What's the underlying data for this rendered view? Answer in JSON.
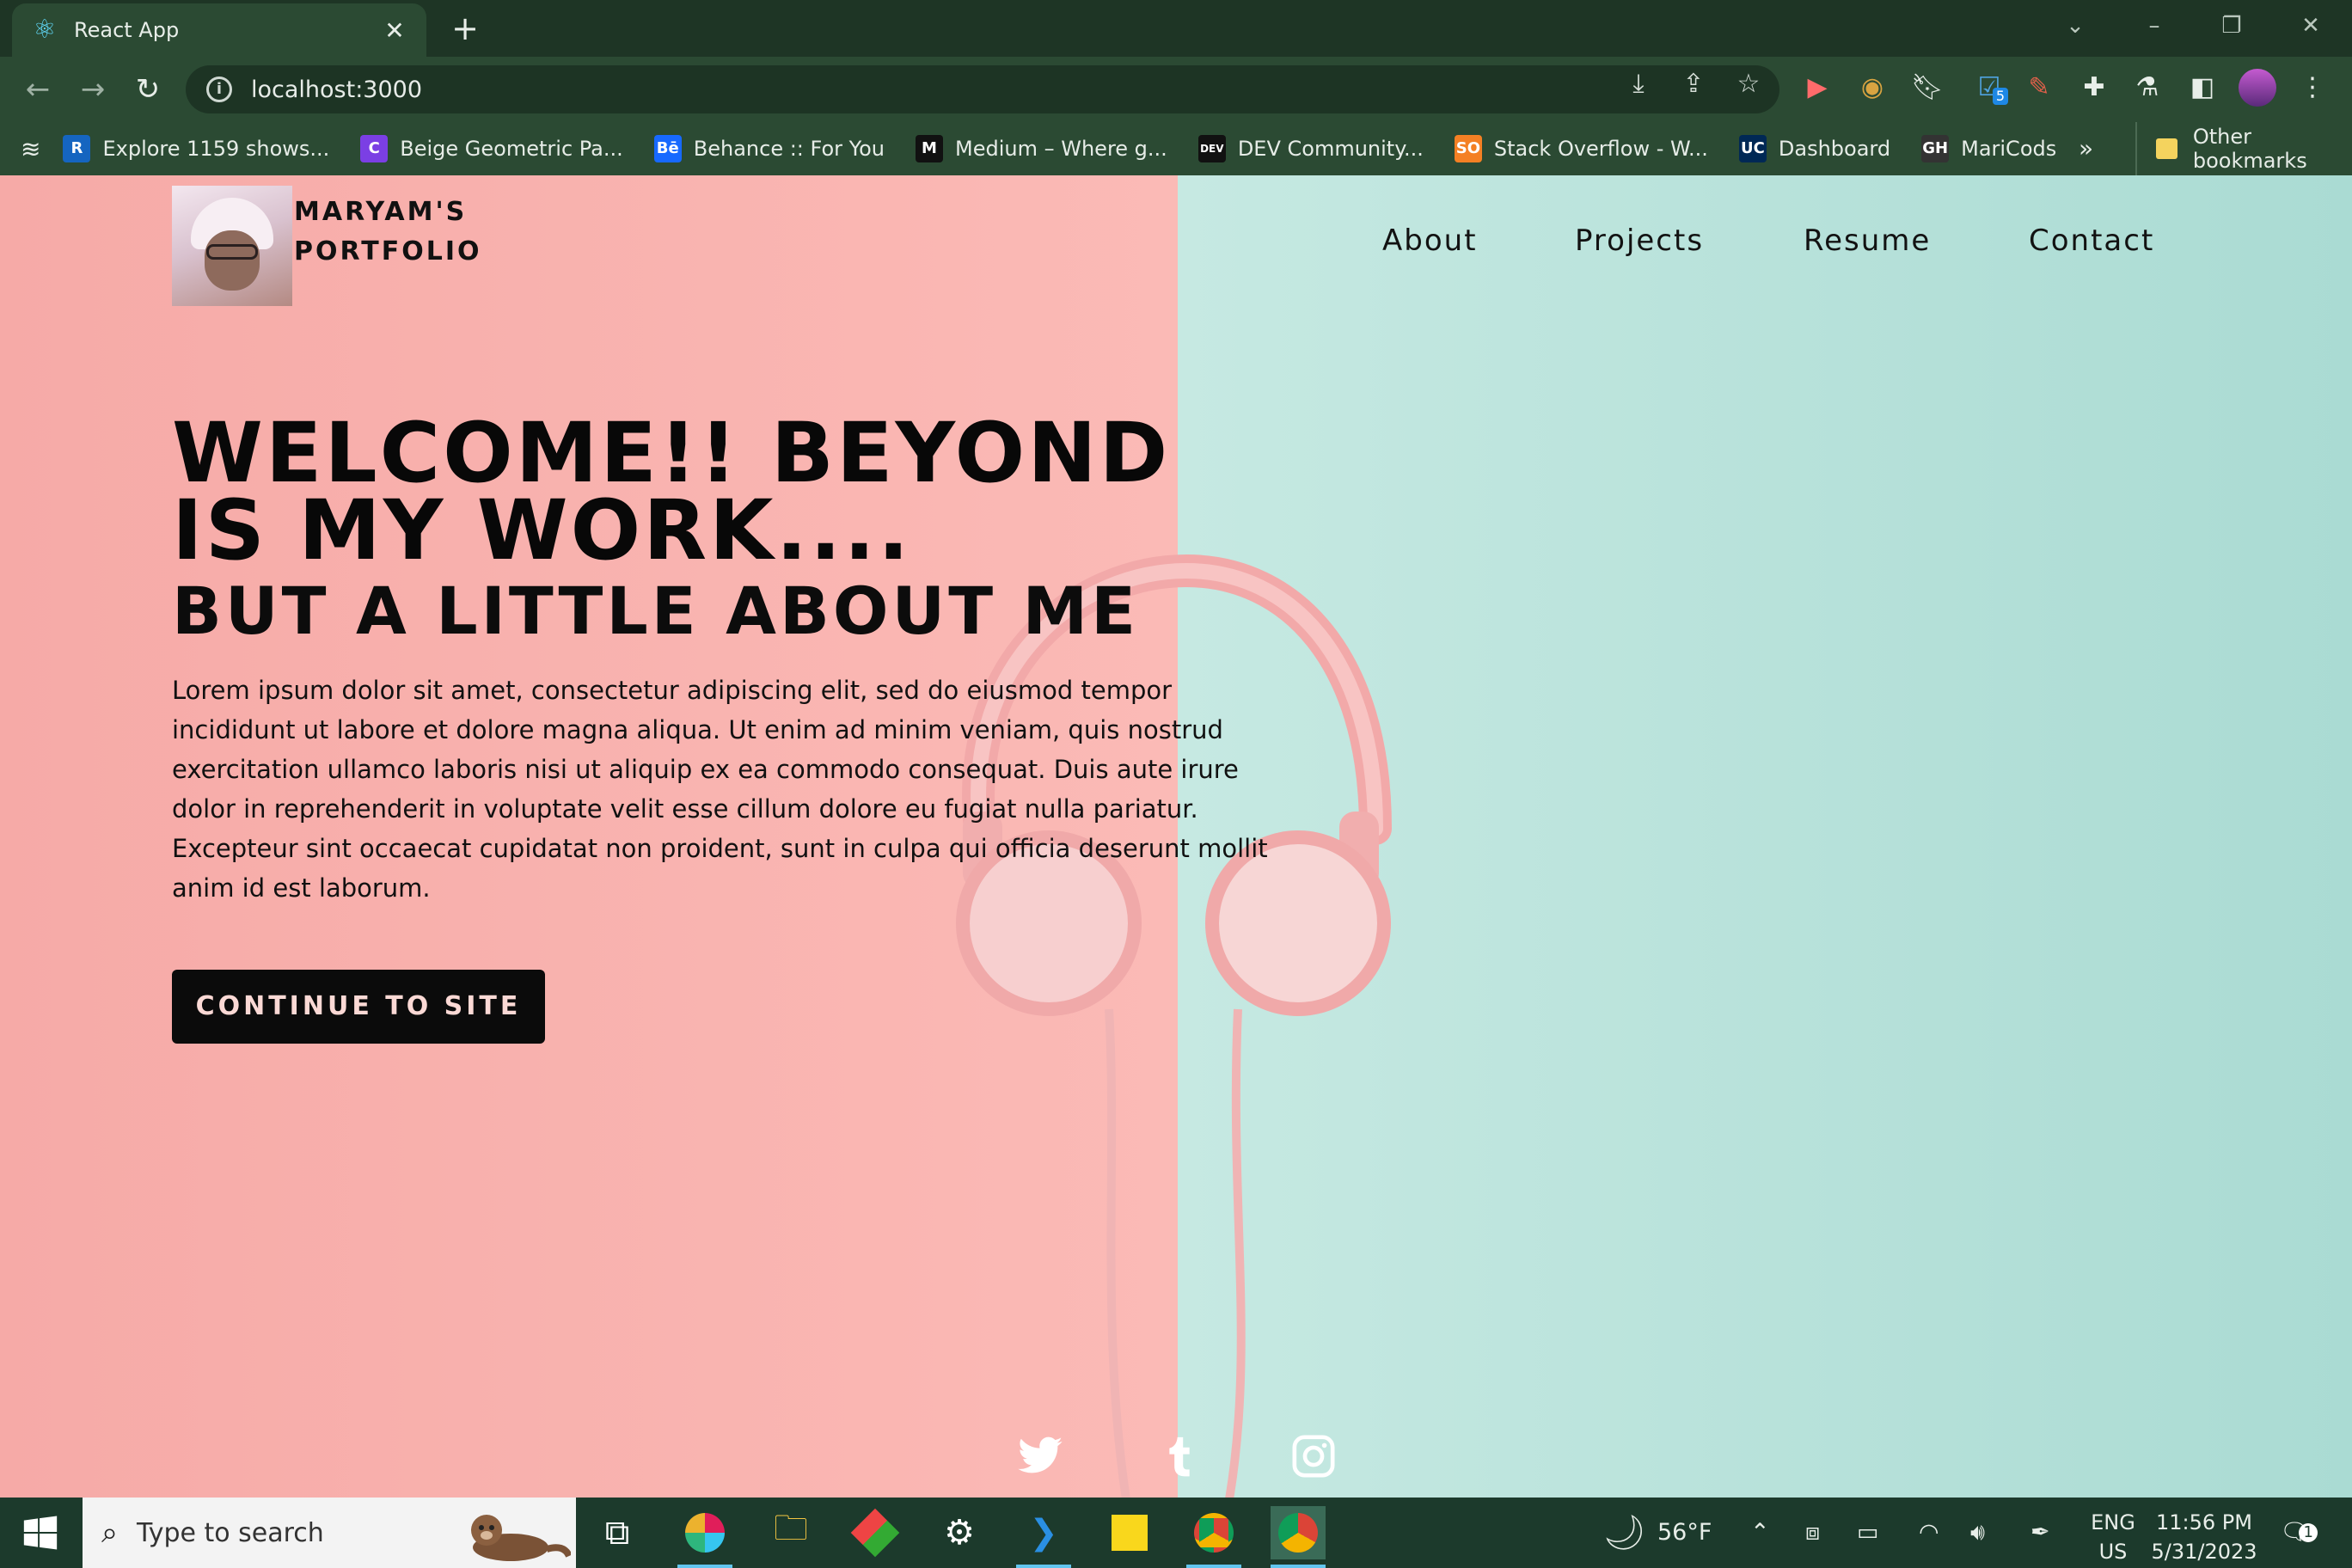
{
  "browser": {
    "tab_title": "React App",
    "url": "localhost:3000",
    "bookmarks": [
      {
        "label": "Explore 1159 shows...",
        "icon": "R"
      },
      {
        "label": "Beige Geometric Pa...",
        "icon": "C"
      },
      {
        "label": "Behance :: For You",
        "icon": "Bē"
      },
      {
        "label": "Medium – Where g...",
        "icon": "M"
      },
      {
        "label": "DEV Community...",
        "icon": "DEV"
      },
      {
        "label": "Stack Overflow - W...",
        "icon": "SO"
      },
      {
        "label": "Dashboard",
        "icon": "UC"
      },
      {
        "label": "MariCods",
        "icon": "GH"
      }
    ],
    "overflow_label": "»",
    "other_bookmarks": "Other bookmarks",
    "extension_badge": "5"
  },
  "page": {
    "brand_line1": "MARYAM'S",
    "brand_line2": "PORTFOLIO",
    "nav": [
      "About",
      "Projects",
      "Resume",
      "Contact"
    ],
    "headline": "WELCOME!! BEYOND IS MY WORK....",
    "subheadline": "BUT A LITTLE ABOUT ME",
    "body": "Lorem ipsum dolor sit amet, consectetur adipiscing elit, sed do eiusmod tempor incididunt ut labore et dolore magna aliqua. Ut enim ad minim veniam, quis nostrud exercitation ullamco laboris nisi ut aliquip ex ea commodo consequat. Duis aute irure dolor in reprehenderit in voluptate velit esse cillum dolore eu fugiat nulla pariatur. Excepteur sint occaecat cupidatat non proident, sunt in culpa qui officia deserunt mollit anim id est laborum.",
    "cta": "CONTINUE TO SITE",
    "social": [
      "twitter-icon",
      "tumblr-icon",
      "instagram-icon"
    ],
    "colors": {
      "pink": "#fbbab6",
      "teal": "#c6e9e2",
      "button": "#0b0b0b"
    }
  },
  "taskbar": {
    "search_placeholder": "Type to search",
    "weather": "56°F",
    "lang_line1": "ENG",
    "lang_line2": "US",
    "time": "11:56 PM",
    "date": "5/31/2023",
    "notification_count": "1"
  }
}
